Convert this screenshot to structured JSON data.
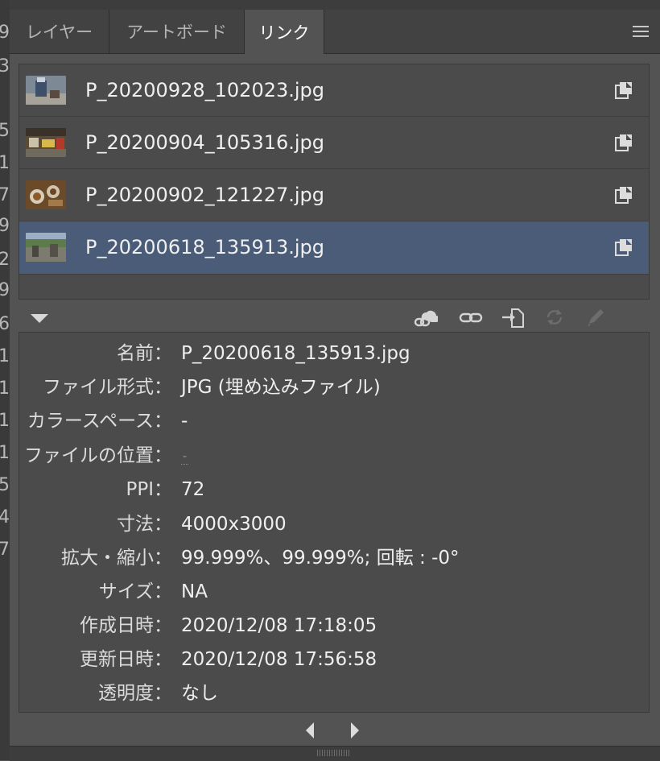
{
  "canvas_strip": {
    "digits": [
      "9",
      "3",
      "5",
      "1",
      "7",
      "9",
      "2",
      "9",
      "6",
      "1",
      "1",
      "1",
      "1",
      "5",
      "4",
      "7"
    ]
  },
  "tabs": [
    {
      "label": "レイヤー",
      "active": false
    },
    {
      "label": "アートボード",
      "active": false
    },
    {
      "label": "リンク",
      "active": true
    }
  ],
  "links": [
    {
      "name": "P_20200928_102023.jpg",
      "thumb": "drink-photo",
      "selected": false
    },
    {
      "name": "P_20200904_105316.jpg",
      "thumb": "street-photo",
      "selected": false
    },
    {
      "name": "P_20200902_121227.jpg",
      "thumb": "food-photo",
      "selected": false
    },
    {
      "name": "P_20200618_135913.jpg",
      "thumb": "landscape-photo",
      "selected": true
    }
  ],
  "toolbar_icons": [
    "cloud-link-icon",
    "relink-icon",
    "go-to-link-icon",
    "update-link-icon",
    "edit-original-icon"
  ],
  "info": {
    "name": {
      "label": "名前：",
      "value": "P_20200618_135913.jpg"
    },
    "format": {
      "label": "ファイル形式：",
      "value": "JPG (埋め込みファイル)"
    },
    "color_space": {
      "label": "カラースペース：",
      "value": "-"
    },
    "location": {
      "label": "ファイルの位置：",
      "value": "-"
    },
    "ppi": {
      "label": "PPI：",
      "value": "72"
    },
    "dimensions": {
      "label": "寸法：",
      "value": "4000x3000"
    },
    "scale": {
      "label": "拡大・縮小：",
      "value": "99.999%、99.999%; 回転 : -0°"
    },
    "size": {
      "label": "サイズ：",
      "value": "NA"
    },
    "created": {
      "label": "作成日時：",
      "value": "2020/12/08 17:18:05"
    },
    "modified": {
      "label": "更新日時：",
      "value": "2020/12/08 17:56:58"
    },
    "transparency": {
      "label": "透明度：",
      "value": "なし"
    }
  },
  "colors": {
    "panel_bg": "#535353",
    "selected_row": "#4a5c77",
    "text": "#efefef"
  }
}
